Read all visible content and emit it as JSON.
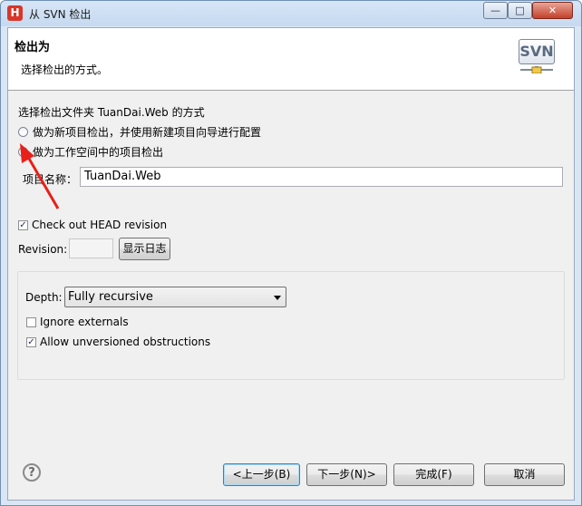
{
  "window": {
    "title": "从 SVN 检出",
    "app_icon_letter": "H",
    "controls": {
      "minimize": "—",
      "maximize": "□",
      "close": "✕"
    }
  },
  "banner": {
    "title": "检出为",
    "description": "选择检出的方式。",
    "logo_text": "SVN"
  },
  "section": {
    "title": "选择检出文件夹 TuanDai.Web 的方式"
  },
  "options": [
    {
      "label": "做为新项目检出，并使用新建项目向导进行配置",
      "checked": false
    },
    {
      "label": "做为工作空间中的项目检出",
      "checked": true
    }
  ],
  "project": {
    "name_label": "项目名称：",
    "name_value": "TuanDai.Web"
  },
  "checkout_head": {
    "label": "Check out HEAD revision",
    "checked": true
  },
  "revision": {
    "label": "Revision:",
    "value": "",
    "show_log_button": "显示日志"
  },
  "depth": {
    "label": "Depth:",
    "selected": "Fully recursive"
  },
  "ignore_externals": {
    "label": "Ignore externals",
    "checked": false
  },
  "allow_unversioned": {
    "label": "Allow unversioned obstructions",
    "checked": true
  },
  "footer": {
    "help_icon": "question-icon",
    "back": "<上一步(B)",
    "next": "下一步(N)>",
    "finish": "完成(F)",
    "cancel": "取消"
  },
  "colors": {
    "annotation_arrow": "#e8201a",
    "radio_dot": "#2b4d7a"
  }
}
